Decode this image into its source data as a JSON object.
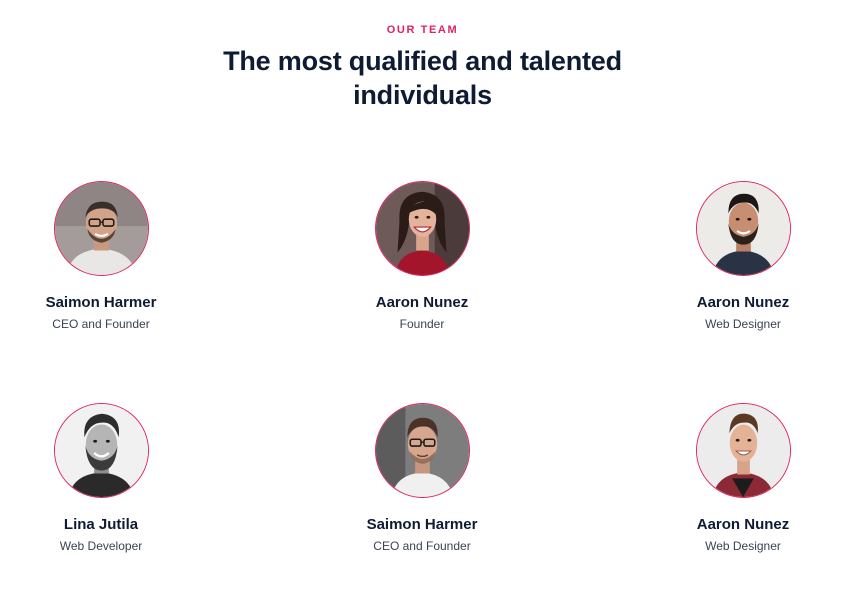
{
  "section": {
    "eyebrow": "OUR TEAM",
    "title": "The most qualified and talented individuals"
  },
  "team": [
    {
      "name": "Saimon Harmer",
      "role": "CEO and Founder",
      "photo_icon": "portrait-glasses-man-icon"
    },
    {
      "name": "Aaron Nunez",
      "role": "Founder",
      "photo_icon": "portrait-smiling-woman-icon"
    },
    {
      "name": "Aaron Nunez",
      "role": "Web Designer",
      "photo_icon": "portrait-bearded-man-icon"
    },
    {
      "name": "Lina Jutila",
      "role": "Web Developer",
      "photo_icon": "portrait-bw-bearded-man-icon"
    },
    {
      "name": "Saimon Harmer",
      "role": "CEO and Founder",
      "photo_icon": "portrait-glasses-man-icon"
    },
    {
      "name": "Aaron Nunez",
      "role": "Web Designer",
      "photo_icon": "portrait-young-man-icon"
    }
  ],
  "colors": {
    "accent": "#e0245e",
    "heading": "#0f1b33",
    "body_text": "#3b4252"
  }
}
